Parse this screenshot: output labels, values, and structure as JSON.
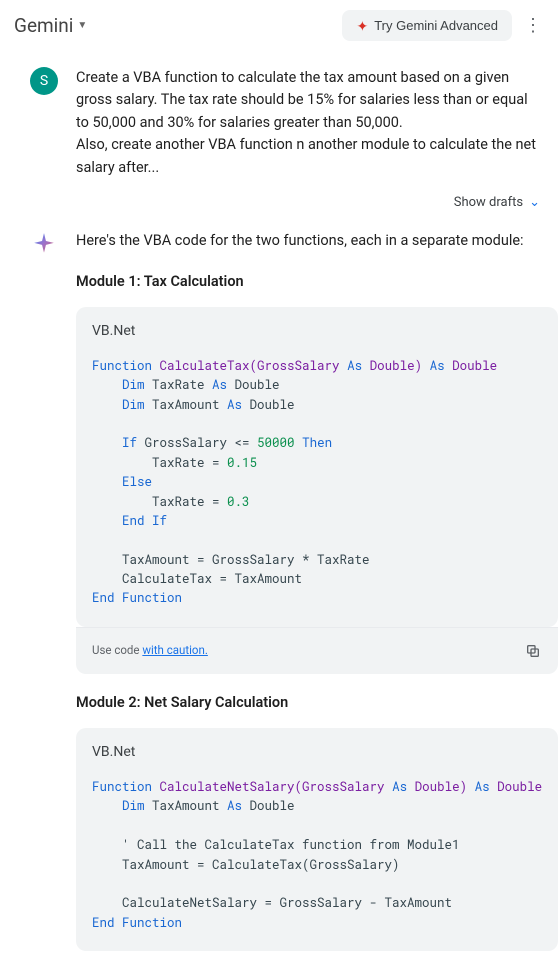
{
  "header": {
    "title": "Gemini",
    "try_advanced": "Try Gemini Advanced"
  },
  "user_avatar_letter": "S",
  "user_message": "Create a VBA function to calculate the tax amount based on a given gross salary. The tax rate should be 15% for salaries less than or equal to 50,000 and 30% for salaries greater than 50,000.\nAlso, create another VBA function n another module to calculate the net salary after...",
  "show_drafts": "Show drafts",
  "ai_intro": "Here's the VBA code for the two functions, each in a separate module:",
  "module1_title": "Module 1: Tax Calculation",
  "module2_title": "Module 2: Net Salary Calculation",
  "code_lang": "VB.Net",
  "code_footer_prefix": "Use code ",
  "code_footer_link": "with caution.",
  "code1": {
    "l1a": "Function",
    "l1b": " CalculateTax(GrossSalary ",
    "l1c": "As",
    "l1d": " Double) ",
    "l1e": "As",
    "l1f": " Double",
    "l2a": "    Dim",
    "l2b": " TaxRate ",
    "l2c": "As",
    "l2d": " Double",
    "l3a": "    Dim",
    "l3b": " TaxAmount ",
    "l3c": "As",
    "l3d": " Double",
    "l4": "",
    "l5a": "    If",
    "l5b": " GrossSalary <= ",
    "l5c": "50000",
    "l5d": " Then",
    "l6a": "        TaxRate = ",
    "l6b": "0.15",
    "l7a": "    Else",
    "l8a": "        TaxRate = ",
    "l8b": "0.3",
    "l9a": "    End",
    "l9b": " If",
    "l10": "",
    "l11": "    TaxAmount = GrossSalary * TaxRate",
    "l12": "    CalculateTax = TaxAmount",
    "l13a": "End",
    "l13b": " Function"
  },
  "code2": {
    "l1a": "Function",
    "l1b": " CalculateNetSalary(GrossSalary ",
    "l1c": "As",
    "l1d": " Double) ",
    "l1e": "As",
    "l1f": " Double",
    "l2a": "    Dim",
    "l2b": " TaxAmount ",
    "l2c": "As",
    "l2d": " Double",
    "l3": "",
    "l4": "    ' Call the CalculateTax function from Module1",
    "l5": "    TaxAmount = CalculateTax(GrossSalary)",
    "l6": "",
    "l7": "    CalculateNetSalary = GrossSalary - TaxAmount",
    "l8a": "End",
    "l8b": " Function"
  }
}
